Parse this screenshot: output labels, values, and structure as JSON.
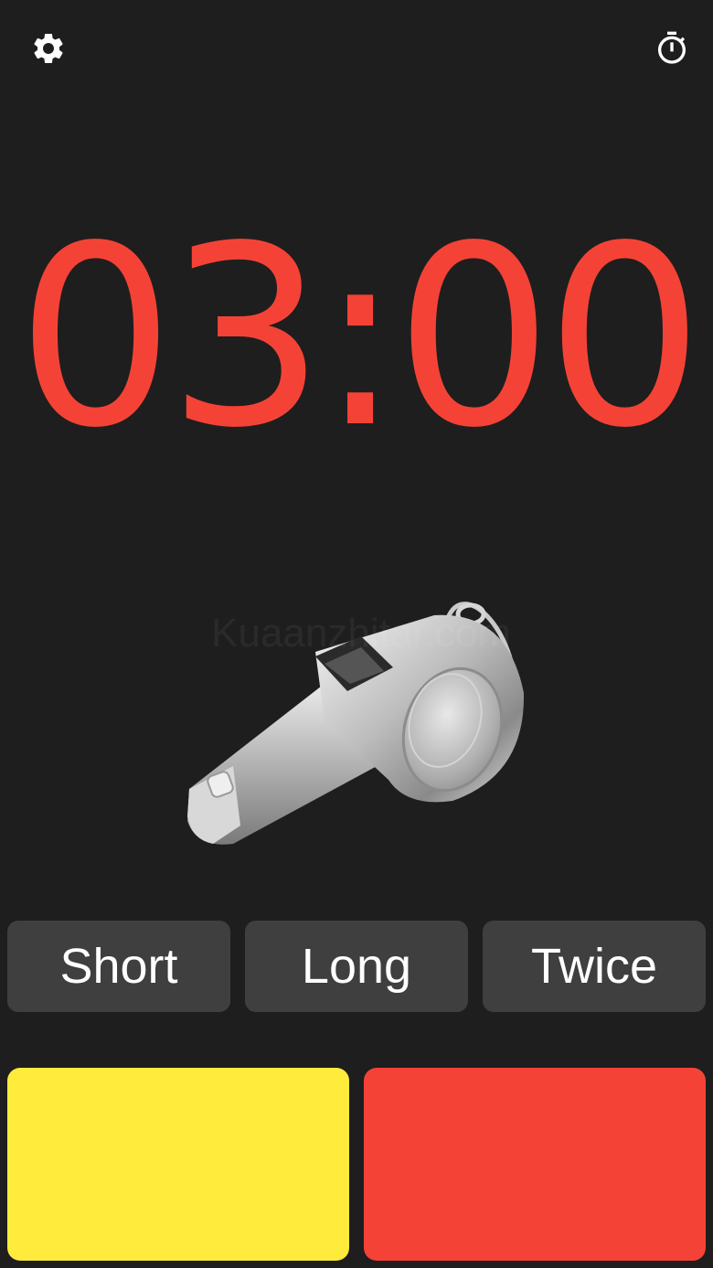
{
  "toolbar": {
    "settings_icon": "gear-icon",
    "stopwatch_icon": "stopwatch-icon"
  },
  "timer": {
    "display": "03:00",
    "color": "#f44336"
  },
  "whistle": {
    "icon": "whistle-image"
  },
  "watermark": {
    "text": "Kuaanzhitar.com"
  },
  "sound_buttons": [
    {
      "label": "Short"
    },
    {
      "label": "Long"
    },
    {
      "label": "Twice"
    }
  ],
  "cards": {
    "yellow": {
      "color": "#ffeb3b"
    },
    "red": {
      "color": "#f44336"
    }
  },
  "colors": {
    "background": "#1e1e1e",
    "button": "#3f3f3f",
    "icon": "#ffffff"
  }
}
